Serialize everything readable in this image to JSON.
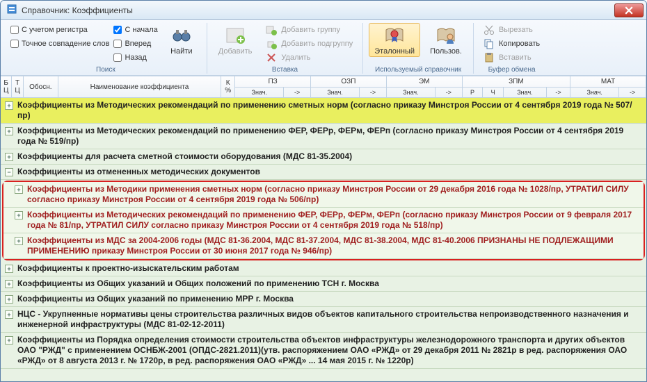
{
  "title": "Справочник: Коэффициенты",
  "ribbon": {
    "groups": {
      "search": {
        "label": "Поиск",
        "with_case": "С учетом регистра",
        "exact_match": "Точное совпадение слов",
        "from_start": "С начала",
        "forward": "Вперед",
        "backward": "Назад",
        "find": "Найти"
      },
      "insert": {
        "label": "Вставка",
        "add": "Добавить",
        "add_group": "Добавить группу",
        "add_subgroup": "Добавить подгруппу",
        "delete": "Удалить"
      },
      "used": {
        "label": "Используемый справочник",
        "ref": "Эталонный",
        "user": "Пользов."
      },
      "clipboard": {
        "label": "Буфер обмена",
        "cut": "Вырезать",
        "copy": "Копировать",
        "paste": "Вставить"
      }
    }
  },
  "grid": {
    "cols": {
      "bc": "Б Ц",
      "tc": "Т Ц",
      "basis": "Обосн.",
      "name": "Наименование коэффициента",
      "kpct": "К %",
      "pz": "ПЗ",
      "ozp": "ОЗП",
      "em": "ЭМ",
      "zpm": "ЗПМ",
      "mat": "МАТ"
    },
    "sub": {
      "zn": "Знач.",
      "arrow": "->",
      "r": "Р",
      "ch": "Ч"
    }
  },
  "rows": [
    "Коэффициенты из Методических рекомендаций по применению сметных норм (согласно приказу Минстроя России от 4 сентября 2019 года № 507/пр)",
    "Коэффициенты из Методических рекомендаций по применению ФЕР, ФЕРр, ФЕРм, ФЕРп (согласно приказу Минстроя России от 4 сентября 2019 года № 519/пр)",
    "Коэффициенты для расчета сметной стоимости оборудования (МДС 81-35.2004)",
    "Коэффициенты из отмененных методических документов",
    "Коэффициенты из Методики применения сметных норм (согласно приказу Минстроя России от 29 декабря 2016 года № 1028/пр, УТРАТИЛ СИЛУ согласно приказу Минстроя России от 4 сентября 2019 года № 506/пр)",
    "Коэффициенты из Методических рекомендаций по применению ФЕР, ФЕРр, ФЕРм, ФЕРп (согласно приказу Минстроя России от 9 февраля 2017 года № 81/пр, УТРАТИЛ СИЛУ согласно приказу Минстроя России от 4 сентября 2019 года № 518/пр)",
    "Коэффициенты из МДС за 2004-2006 годы (МДС 81-36.2004, МДС 81-37.2004, МДС 81-38.2004, МДС 81-40.2006 ПРИЗНАНЫ НЕ ПОДЛЕЖАЩИМИ ПРИМЕНЕНИЮ приказу Минстроя России от 30 июня 2017 года № 946/пр)",
    "Коэффициенты к проектно-изыскательским работам",
    "Коэффициенты из Общих указаний и Общих положений по применению ТСН г. Москва",
    "Коэффициенты из Общих указаний по применению МРР г. Москва",
    "НЦС - Укрупненные нормативы цены строительства различных видов объектов капитального строительства непроизводственного назначения и инженерной инфраструктуры (МДС 81-02-12-2011)",
    "Коэффициенты из Порядка определения стоимости строительства объектов инфраструктуры железнодорожного транспорта и других объектов ОАО \"РЖД\" с применением ОСНБЖ-2001 (ОПДС-2821.2011)(утв. распоряжением ОАО «РЖД» от 29 декабря 2011 № 2821р в ред. распоряжения ОАО «РЖД» от 8 августа 2013 г. № 1720р, в ред. распоряжения ОАО «РЖД» ... 14 мая 2015 г. № 1220р)"
  ]
}
